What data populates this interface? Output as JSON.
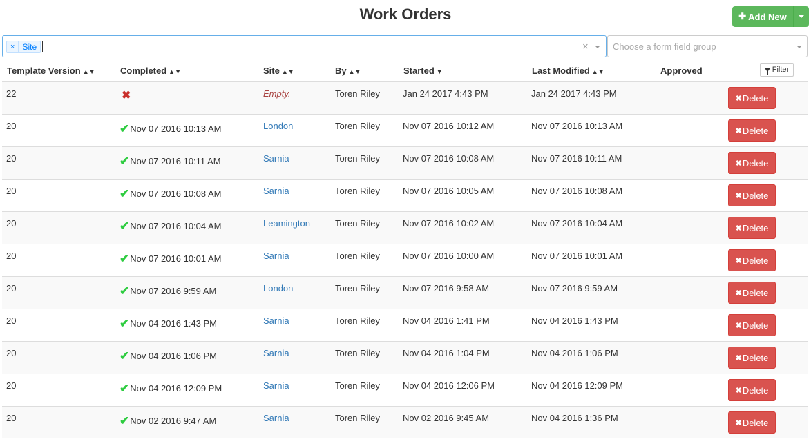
{
  "page": {
    "title": "Work Orders"
  },
  "toolbar": {
    "add_new_label": "Add New",
    "add_new_icon": "plus-icon"
  },
  "filters": {
    "tags": [
      {
        "remove": "×",
        "label": "Site"
      }
    ],
    "clear_symbol": "×",
    "group_placeholder": "Choose a form field group"
  },
  "table": {
    "headers": {
      "template_version": "Template Version",
      "completed": "Completed",
      "site": "Site",
      "by": "By",
      "started": "Started",
      "last_modified": "Last Modified",
      "approved": "Approved"
    },
    "filter_label": "Filter",
    "delete_label": "Delete",
    "rows": [
      {
        "version": "22",
        "completed": "",
        "done": false,
        "site": "Empty.",
        "site_empty": true,
        "by": "Toren Riley",
        "started": "Jan 24 2017 4:43 PM",
        "modified": "Jan 24 2017 4:43 PM"
      },
      {
        "version": "20",
        "completed": "Nov 07 2016 10:13 AM",
        "done": true,
        "site": "London",
        "by": "Toren Riley",
        "started": "Nov 07 2016 10:12 AM",
        "modified": "Nov 07 2016 10:13 AM"
      },
      {
        "version": "20",
        "completed": "Nov 07 2016 10:11 AM",
        "done": true,
        "site": "Sarnia",
        "by": "Toren Riley",
        "started": "Nov 07 2016 10:08 AM",
        "modified": "Nov 07 2016 10:11 AM"
      },
      {
        "version": "20",
        "completed": "Nov 07 2016 10:08 AM",
        "done": true,
        "site": "Sarnia",
        "by": "Toren Riley",
        "started": "Nov 07 2016 10:05 AM",
        "modified": "Nov 07 2016 10:08 AM"
      },
      {
        "version": "20",
        "completed": "Nov 07 2016 10:04 AM",
        "done": true,
        "site": "Leamington",
        "by": "Toren Riley",
        "started": "Nov 07 2016 10:02 AM",
        "modified": "Nov 07 2016 10:04 AM"
      },
      {
        "version": "20",
        "completed": "Nov 07 2016 10:01 AM",
        "done": true,
        "site": "Sarnia",
        "by": "Toren Riley",
        "started": "Nov 07 2016 10:00 AM",
        "modified": "Nov 07 2016 10:01 AM"
      },
      {
        "version": "20",
        "completed": "Nov 07 2016 9:59 AM",
        "done": true,
        "site": "London",
        "by": "Toren Riley",
        "started": "Nov 07 2016 9:58 AM",
        "modified": "Nov 07 2016 9:59 AM"
      },
      {
        "version": "20",
        "completed": "Nov 04 2016 1:43 PM",
        "done": true,
        "site": "Sarnia",
        "by": "Toren Riley",
        "started": "Nov 04 2016 1:41 PM",
        "modified": "Nov 04 2016 1:43 PM"
      },
      {
        "version": "20",
        "completed": "Nov 04 2016 1:06 PM",
        "done": true,
        "site": "Sarnia",
        "by": "Toren Riley",
        "started": "Nov 04 2016 1:04 PM",
        "modified": "Nov 04 2016 1:06 PM"
      },
      {
        "version": "20",
        "completed": "Nov 04 2016 12:09 PM",
        "done": true,
        "site": "Sarnia",
        "by": "Toren Riley",
        "started": "Nov 04 2016 12:06 PM",
        "modified": "Nov 04 2016 12:09 PM"
      },
      {
        "version": "20",
        "completed": "Nov 02 2016 9:47 AM",
        "done": true,
        "site": "Sarnia",
        "by": "Toren Riley",
        "started": "Nov 02 2016 9:45 AM",
        "modified": "Nov 04 2016 1:36 PM"
      }
    ]
  },
  "colors": {
    "accent_green": "#5cb85c",
    "danger_red": "#d9534f",
    "link_blue": "#337ab7",
    "check_green": "#2ecc40"
  }
}
